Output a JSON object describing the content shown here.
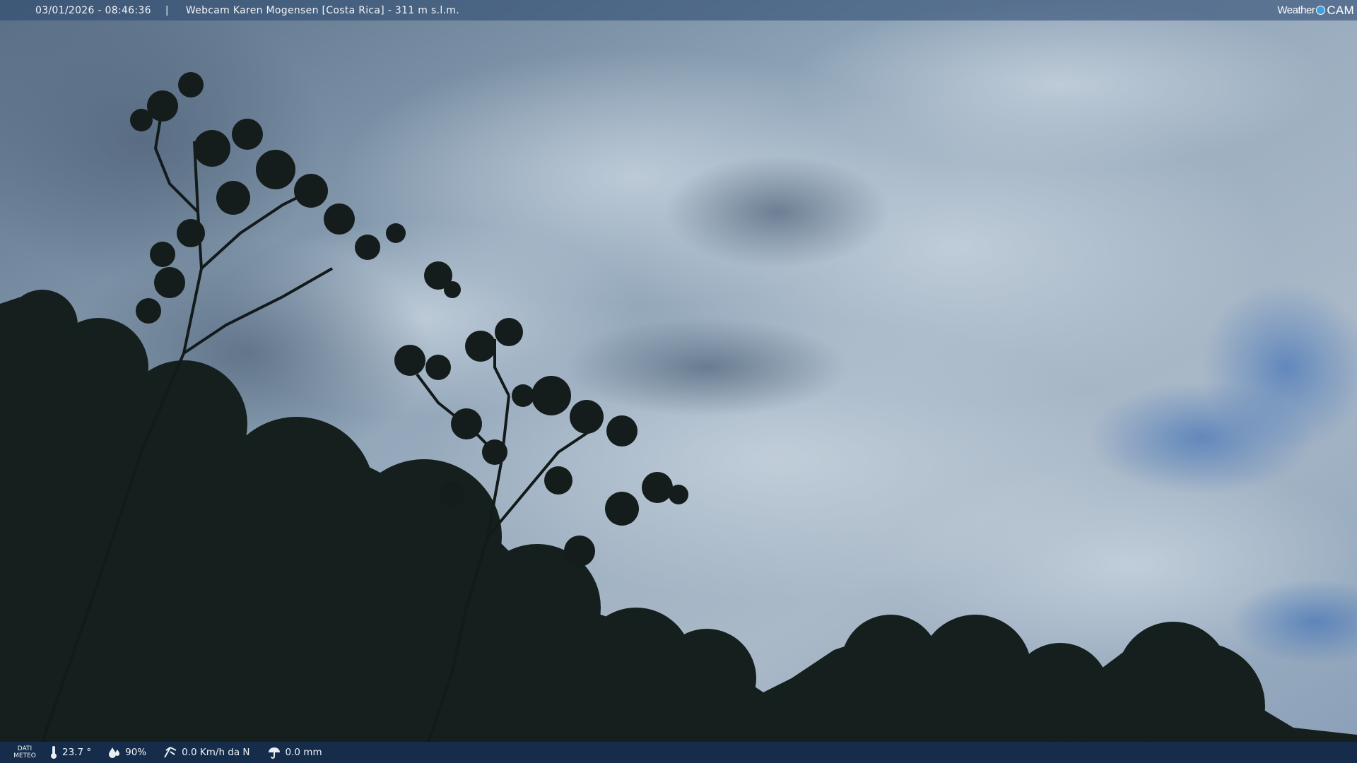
{
  "header": {
    "timestamp": "03/01/2026 - 08:46:36",
    "separator": "|",
    "title": "Webcam Karen Mogensen [Costa Rica]  - 311 m s.l.m.",
    "logo_weather": "Weather",
    "logo_cam": "CAM"
  },
  "footer": {
    "dati_meteo_line1": "DATI",
    "dati_meteo_line2": "METEO",
    "temperature": "23.7 °",
    "humidity": "90%",
    "wind": "0.0 Km/h da N",
    "rain": "0.0 mm"
  },
  "colors": {
    "sky": "#9fb3c6",
    "bar": "#1c3c64",
    "foliage": "#141d1d"
  },
  "icons": [
    "thermometer-icon",
    "humidity-drop-icon",
    "wind-icon",
    "rain-icon"
  ]
}
